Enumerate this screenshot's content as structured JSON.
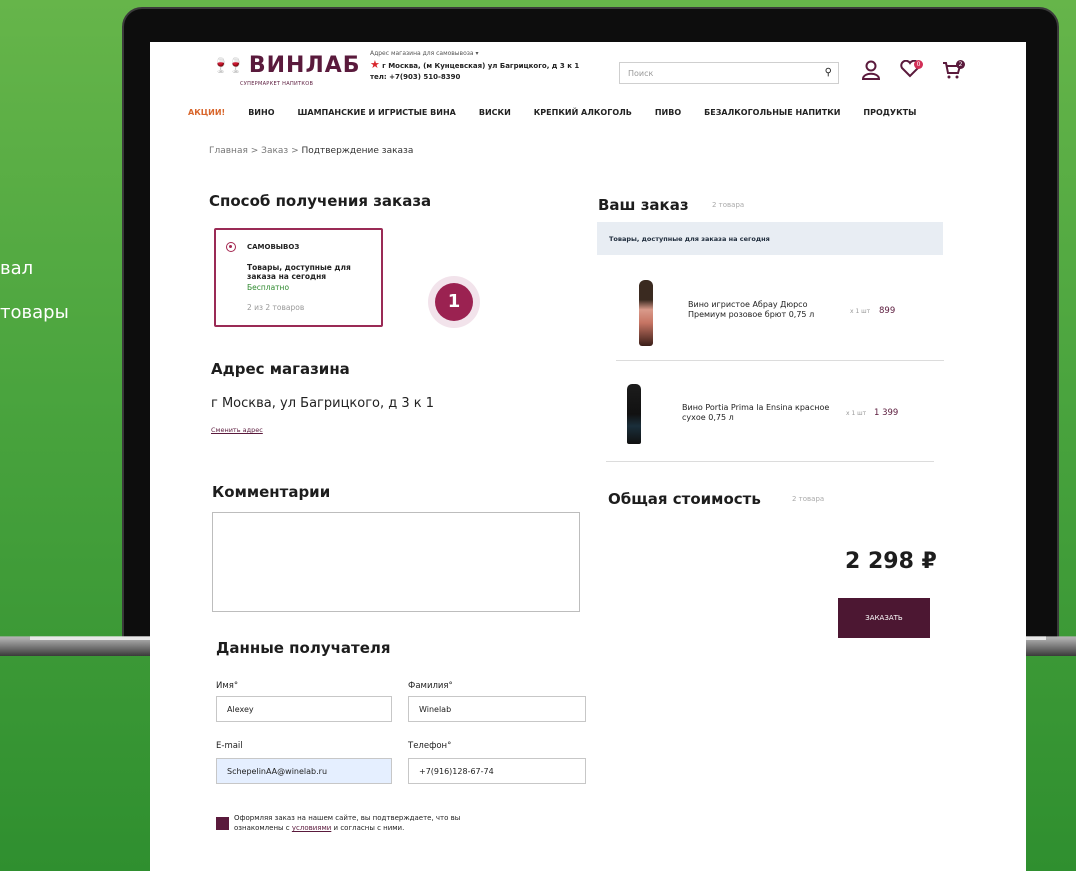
{
  "background": {
    "line1": "вал",
    "line2": "товары"
  },
  "header": {
    "logo_text": "ВИНЛАБ",
    "logo_sub": "СУПЕРМАРКЕТ НАПИТКОВ",
    "store_caption": "Адрес магазина для самовывоза ▾",
    "store_address": "г Москва, (м Кунцевская) ул Багрицкого, д 3 к 1",
    "store_phone": "тел: +7(903) 510-8390",
    "search_placeholder": "Поиск",
    "favorites_count": "0",
    "cart_count": "2"
  },
  "nav": {
    "items": [
      "АКЦИИ!",
      "ВИНО",
      "ШАМПАНСКИЕ И ИГРИСТЫЕ ВИНА",
      "ВИСКИ",
      "КРЕПКИЙ АЛКОГОЛЬ",
      "ПИВО",
      "БЕЗАЛКОГОЛЬНЫЕ НАПИТКИ",
      "ПРОДУКТЫ"
    ]
  },
  "breadcrumb": {
    "home": "Главная",
    "order": "Заказ",
    "current": "Подтверждение заказа",
    "sep": ">"
  },
  "delivery": {
    "title": "Способ получения заказа",
    "option_title": "САМОВЫВОЗ",
    "option_desc": "Товары, доступные для заказа на сегодня",
    "option_price": "Бесплатно",
    "option_count": "2 из 2 товаров"
  },
  "step_marker": "1",
  "store_address_section": {
    "title": "Адрес магазина",
    "address": "г Москва, ул Багрицкого, д 3 к 1",
    "change_link": "Сменить адрес"
  },
  "comments": {
    "title": "Комментарии",
    "value": ""
  },
  "recipient": {
    "title": "Данные получателя",
    "first_name_label": "Имя°",
    "first_name_value": "Alexey",
    "last_name_label": "Фамилия°",
    "last_name_value": "Winelab",
    "email_label": "E-mail",
    "email_value": "SchepelinAA@winelab.ru",
    "phone_label": "Телефон°",
    "phone_value": "+7(916)128-67-74",
    "agree_text_1": "Оформляя заказ на нашем сайте, вы подтверждаете, что вы ознакомлены с ",
    "agree_link": "условиями",
    "agree_text_2": " и согласны с ними."
  },
  "order": {
    "title": "Ваш заказ",
    "count": "2 товара",
    "availability": "Товары, доступные для заказа на сегодня",
    "items": [
      {
        "name": "Вино игристое Абрау Дюрсо Премиум розовое брют 0,75 л",
        "qty": "x 1 шт",
        "price": "899"
      },
      {
        "name": "Вино Portia Prima la Ensina красное сухое 0,75 л",
        "qty": "x 1 шт",
        "price": "1 399"
      }
    ]
  },
  "total": {
    "title": "Общая стоимость",
    "count": "2 товара",
    "amount": "2 298 ₽",
    "order_button": "ЗАКАЗАТЬ"
  }
}
